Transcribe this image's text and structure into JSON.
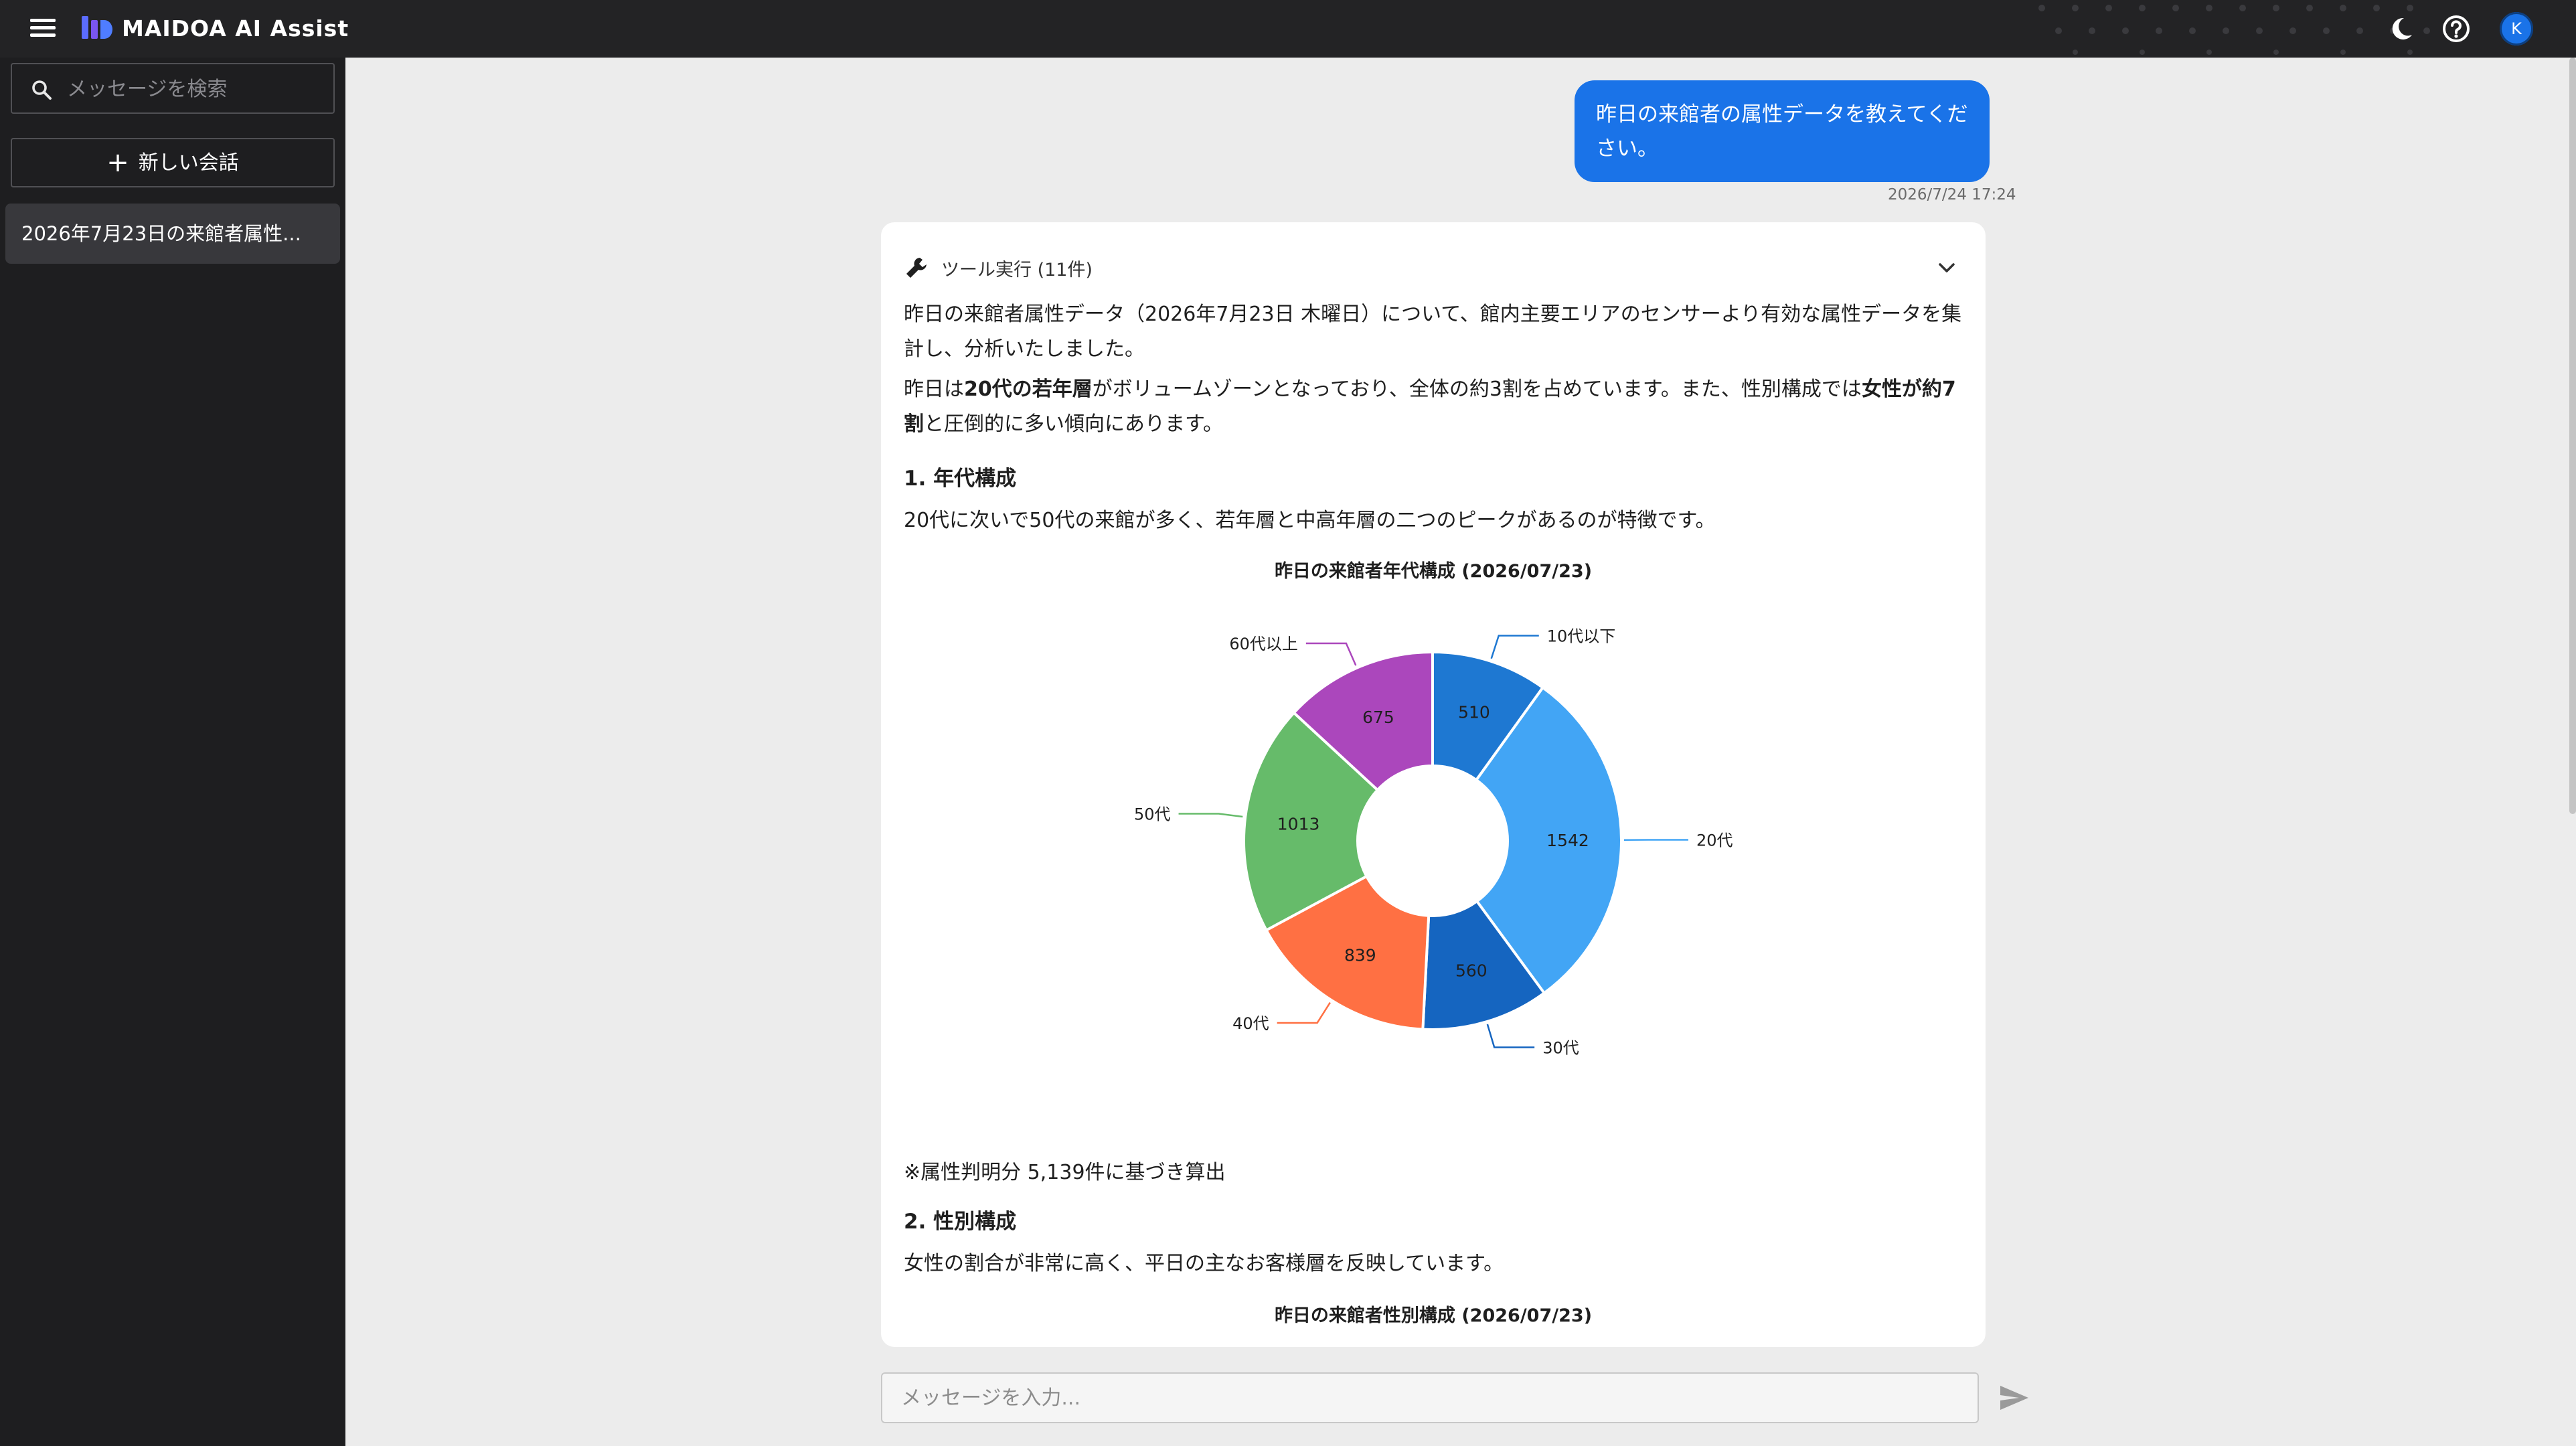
{
  "app": {
    "brand": "MAIDOA AI Assist",
    "avatar_initial": "K",
    "accent": "#1a73e8"
  },
  "topbar": {
    "icons": [
      "menu-icon",
      "moon-icon",
      "help-icon"
    ]
  },
  "sidebar": {
    "search_placeholder": "メッセージを検索",
    "new_chat_label": "新しい会話",
    "conversations": [
      {
        "title": "2026年7月23日の来館者属性..."
      }
    ]
  },
  "chat": {
    "user_message": "昨日の来館者の属性データを教えてください。",
    "user_timestamp": "2026/7/24 17:24",
    "tool_summary": "ツール実行 (11件)",
    "intro": "昨日の来館者属性データ（2026年7月23日 木曜日）について、館内主要エリアのセンサーより有効な属性データを集計し、分析いたしました。",
    "summary_parts": [
      "昨日は",
      "20代の若年層",
      "がボリュームゾーンとなっており、全体の約3割を占めています。また、性別構成では",
      "女性が約7割",
      "と圧倒的に多い傾向にあります。"
    ],
    "section1_title": "1. 年代構成",
    "section1_text": "20代に次いで50代の来館が多く、若年層と中高年層の二つのピークがあるのが特徴です。",
    "footnote": "※属性判明分 5,139件に基づき算出",
    "section2_title": "2. 性別構成",
    "section2_text": "女性の割合が非常に高く、平日の主なお客様層を反映しています。",
    "chart2_title": "昨日の来館者性別構成 (2026/07/23)",
    "input_placeholder": "メッセージを入力..."
  },
  "chart_data": {
    "type": "pie",
    "title": "昨日の来館者年代構成 (2026/07/23)",
    "donut": true,
    "categories": [
      "10代以下",
      "20代",
      "30代",
      "40代",
      "50代",
      "60代以上"
    ],
    "values": [
      510,
      1542,
      560,
      839,
      1013,
      675
    ],
    "colors": [
      "#1e78d2",
      "#42a5f5",
      "#1565c0",
      "#ff7043",
      "#66bb6a",
      "#ab47bc"
    ]
  }
}
